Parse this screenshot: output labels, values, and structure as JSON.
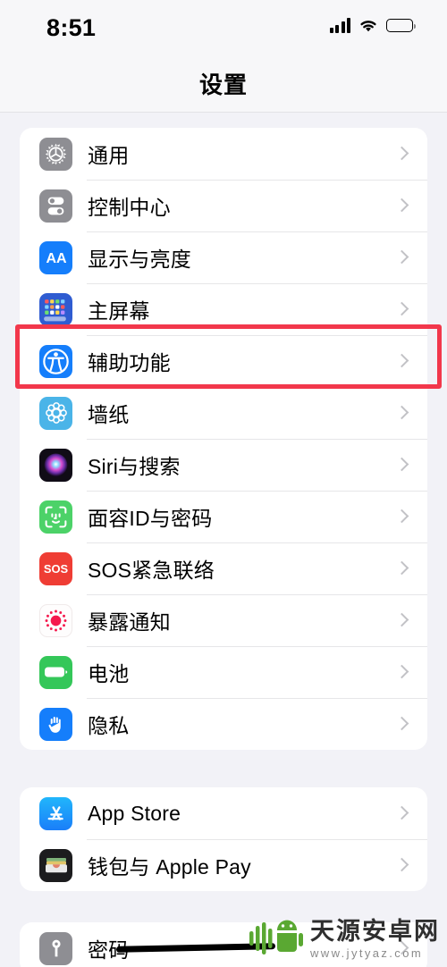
{
  "status_bar": {
    "time": "8:51",
    "signal_icon": "cellular-signal-icon",
    "wifi_icon": "wifi-icon",
    "battery_icon": "battery-full-icon"
  },
  "nav": {
    "title": "设置"
  },
  "highlight": {
    "color": "#f2374b",
    "target": "辅助功能"
  },
  "groups": [
    {
      "id": "group-system",
      "items": [
        {
          "label": "通用",
          "icon": "gear-icon",
          "color": "#8e8e93"
        },
        {
          "label": "控制中心",
          "icon": "control-center-icon",
          "color": "#8e8e93"
        },
        {
          "label": "显示与亮度",
          "icon": "display-brightness-icon",
          "color": "#157efb"
        },
        {
          "label": "主屏幕",
          "icon": "home-screen-icon",
          "color": "#2f5cd1"
        },
        {
          "label": "辅助功能",
          "icon": "accessibility-icon",
          "color": "#157efb"
        },
        {
          "label": "墙纸",
          "icon": "wallpaper-icon",
          "color": "#4ab4e8"
        },
        {
          "label": "Siri与搜索",
          "icon": "siri-icon",
          "color": "#1c1c1e"
        },
        {
          "label": "面容ID与密码",
          "icon": "face-id-icon",
          "color": "#4cd268"
        },
        {
          "label": "SOS紧急联络",
          "icon": "sos-icon",
          "color": "#ef3d34"
        },
        {
          "label": "暴露通知",
          "icon": "exposure-notification-icon",
          "color": "#ffffff"
        },
        {
          "label": "电池",
          "icon": "battery-icon",
          "color": "#34c759"
        },
        {
          "label": "隐私",
          "icon": "privacy-hand-icon",
          "color": "#157efb"
        }
      ]
    },
    {
      "id": "group-store",
      "items": [
        {
          "label": "App Store",
          "icon": "app-store-icon",
          "color": "#1f9dfb"
        },
        {
          "label": "钱包与 Apple Pay",
          "icon": "wallet-icon",
          "color": "#1c1c1e"
        }
      ]
    },
    {
      "id": "group-passwords",
      "items": [
        {
          "label": "密码",
          "icon": "key-icon",
          "color": "#8e8e93"
        }
      ]
    }
  ],
  "watermark": {
    "name": "天源安卓网",
    "url": "www.jytyaz.com",
    "logo": "android-robot-icon",
    "logo_color": "#5aa832"
  }
}
